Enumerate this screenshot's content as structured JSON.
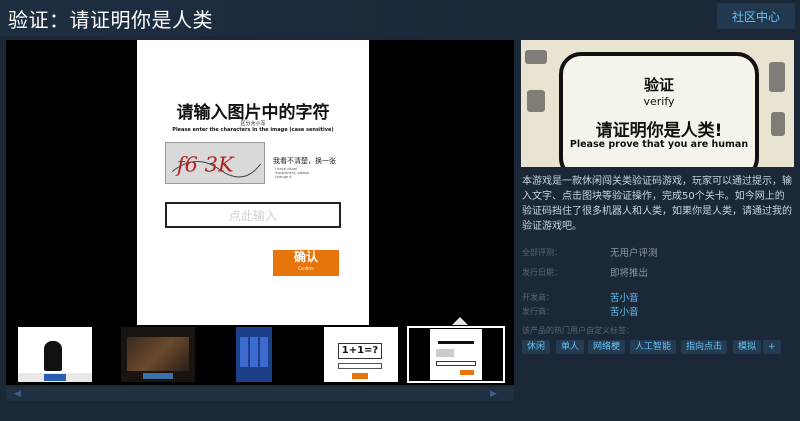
{
  "header": {
    "title": "验证：请证明你是人类",
    "community_hub": "社区中心"
  },
  "screenshot": {
    "title": "请输入图片中的字符",
    "sub_case": "区分大小写",
    "sub_en": "Please enter the characters in the image    (case sensitive)",
    "captcha_text": "f6 3K",
    "change_text": "我看不清楚，换一张",
    "change_sub": "I have visual impairment, please change it",
    "input_placeholder": "点此输入",
    "confirm": "确认",
    "confirm_sub": "Confirm"
  },
  "thumbnails": [
    {
      "label": "thumbnail-1"
    },
    {
      "label": "thumbnail-2"
    },
    {
      "label": "thumbnail-3"
    },
    {
      "label": "thumbnail-4",
      "text": "1+1=?"
    },
    {
      "label": "thumbnail-5"
    }
  ],
  "capsule": {
    "verify_cn": "验证",
    "verify_en": "verify",
    "prove_cn": "请证明你是人类!",
    "prove_en": "Please prove that you are human"
  },
  "description": "本游戏是一款休闲闯关类验证码游戏，玩家可以通过提示，输入文字、点击图块等验证操作，完成50个关卡。如今网上的验证码挡住了很多机器人和人类，如果你是人类，请通过我的验证游戏吧。",
  "info": {
    "reviews_label": "全部评测：",
    "reviews_value": "无用户评测",
    "release_label": "发行日期：",
    "release_value": "即将推出",
    "developer_label": "开发商：",
    "developer_value": "苦小音",
    "publisher_label": "发行商：",
    "publisher_value": "苦小音"
  },
  "tags": {
    "label": "该产品的热门用户自定义标签：",
    "items": [
      "休闲",
      "单人",
      "网络梗",
      "人工智能",
      "指向点击",
      "模拟",
      "+"
    ]
  },
  "colors": {
    "accent": "#67c1f5",
    "background": "#1b2838",
    "confirm": "#e8740c"
  }
}
